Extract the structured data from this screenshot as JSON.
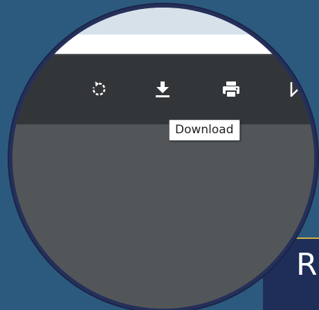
{
  "background": {
    "banner_text": "R",
    "color": "#2c5a7e",
    "banner_color": "#1e2e58",
    "rule_color": "#d4b24a"
  },
  "viewer_toolbar": {
    "buttons": [
      {
        "name": "rotate-button",
        "icon": "rotate-icon"
      },
      {
        "name": "download-button",
        "icon": "download-icon"
      },
      {
        "name": "print-button",
        "icon": "print-icon"
      },
      {
        "name": "more-actions-button",
        "icon": "partial-icon"
      }
    ],
    "tooltip": "Download",
    "toolbar_color": "#333639",
    "content_color": "#535659"
  }
}
